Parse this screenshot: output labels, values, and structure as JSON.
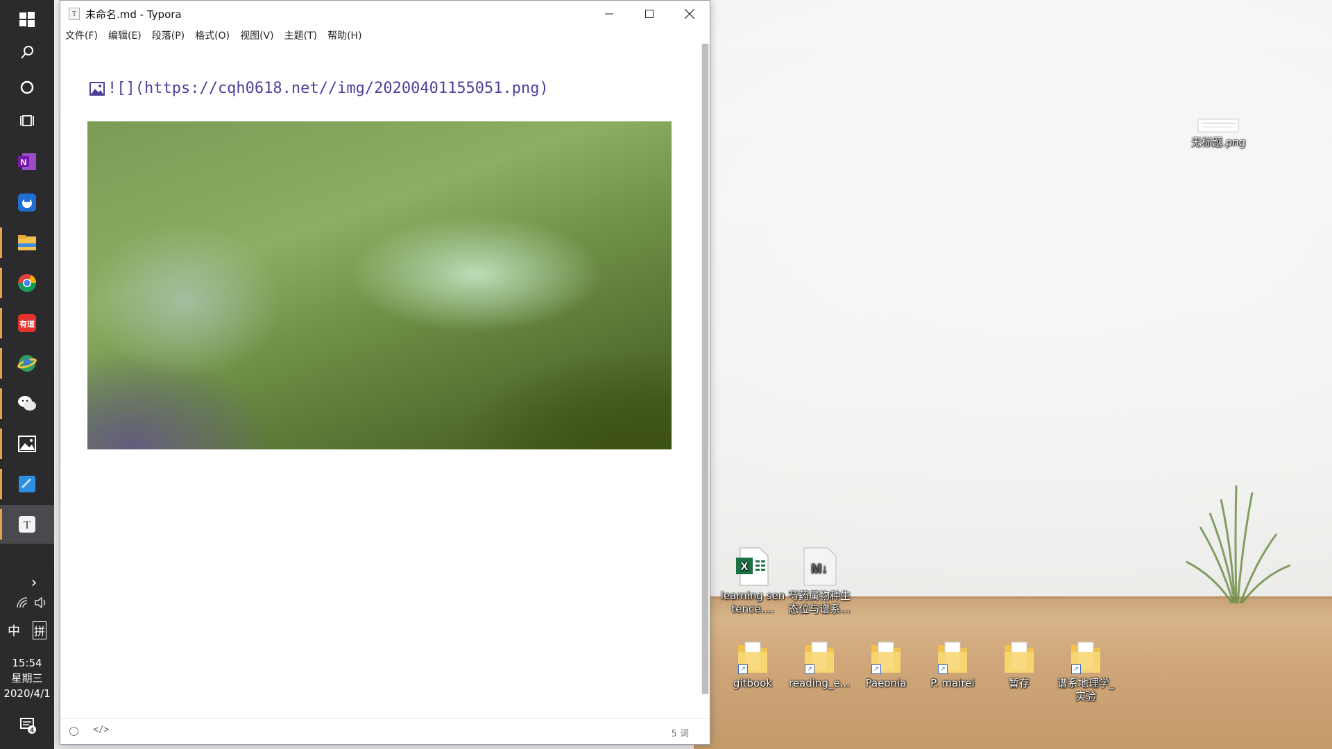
{
  "window": {
    "title": "未命名.md - Typora",
    "app_icon_letter": "T",
    "menu": [
      "文件(F)",
      "编辑(E)",
      "段落(P)",
      "格式(O)",
      "视图(V)",
      "主题(T)",
      "帮助(H)"
    ]
  },
  "editor": {
    "image_markdown": "![](https://cqh0618.net//img/20200401155051.png)",
    "status_code_toggle": "</>",
    "word_count": "5 词"
  },
  "taskbar": {
    "apps": [
      "start-icon",
      "search-icon",
      "cortana-icon",
      "task-view-icon",
      "onenote-icon",
      "app-blue-icon",
      "file-explorer-icon",
      "chrome-icon",
      "youdao-icon",
      "app-green-icon",
      "wechat-icon",
      "photos-icon",
      "app-tile-icon",
      "typora-icon"
    ],
    "youdao_label": "有道",
    "typora_letter": "T",
    "onenote_letter": "N",
    "ime_lang": "中",
    "ime_mode": "拼",
    "expand_glyph": "›",
    "time": "15:54",
    "weekday": "星期三",
    "date": "2020/4/1",
    "notification_count": "4"
  },
  "desktop": {
    "top_file": "无标题.png",
    "files": [
      {
        "label": "learning sentence....",
        "type": "excel"
      },
      {
        "label": "芍药属物种生态位与谱系...",
        "type": "markdown"
      }
    ],
    "folders": [
      "gitbook",
      "reading_e...",
      "Paeonia",
      "P. mairei",
      "暂存",
      "谱系地理学_实验"
    ]
  },
  "colors": {
    "taskbar": "#2b2b2e",
    "accent": "#e6a34e",
    "markdown_text": "#4b3f9a"
  }
}
